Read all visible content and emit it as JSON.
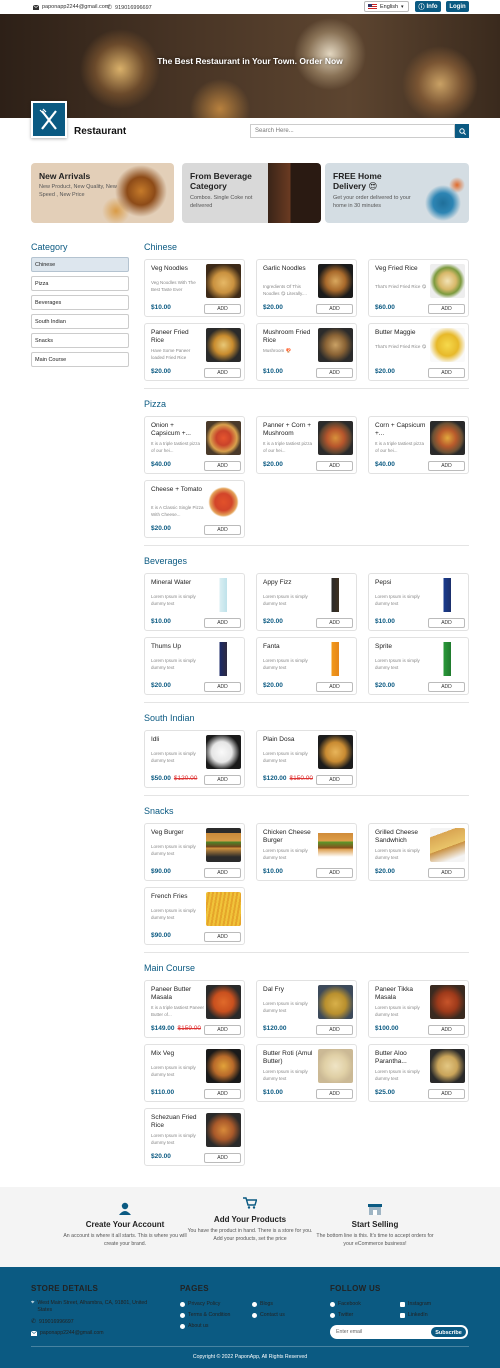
{
  "topbar": {
    "email": "paponapp2244@gmail.com",
    "phone": "919016996697",
    "language": "English",
    "info_label": "Info",
    "login_label": "Login"
  },
  "hero": {
    "title": "The Best Restaurant in Your Town. Order Now"
  },
  "header": {
    "brand": "Restaurant",
    "search_placeholder": "Search Here..."
  },
  "banners": [
    {
      "title": "New Arrivals",
      "subtitle": "New Product, New Quality, New Speed , New Price",
      "bg": "#e3cfb8"
    },
    {
      "title": "From Beverage Category",
      "subtitle": "Combos. Single Coke not delivered",
      "bg": "#d9d9d9"
    },
    {
      "title": "FREE Home Delivery 😍",
      "subtitle": "Get your order delivered to your home in 30 minutes",
      "bg": "#d4dde3"
    }
  ],
  "sidebar": {
    "title": "Category",
    "items": [
      "Chinese",
      "Pizza",
      "Beverages",
      "South Indian",
      "Snacks",
      "Main Course"
    ]
  },
  "add_label": "ADD",
  "sections": [
    {
      "title": "Chinese",
      "items": [
        {
          "name": "Veg Noodles",
          "desc": "Veg Noodles With The Best Taste Ever",
          "price": "$10.00",
          "old": "",
          "img": "noodles"
        },
        {
          "name": "Garlic Noodles",
          "desc": "Ingredients Of This Noodles 😋 Literally....",
          "price": "$20.00",
          "old": "",
          "img": "noodles2"
        },
        {
          "name": "Veg Fried Rice",
          "desc": "That's Fried Fried Rice 😋",
          "price": "$60.00",
          "old": "",
          "img": "rice"
        },
        {
          "name": "Paneer Fried Rice",
          "desc": "Have Some Paneer loaded Fried Rice",
          "price": "$20.00",
          "old": "",
          "img": "rice2"
        },
        {
          "name": "Mushroom Fried Rice",
          "desc": "Mushroom 🍄",
          "price": "$10.00",
          "old": "",
          "img": "rice3"
        },
        {
          "name": "Butter Maggie",
          "desc": "That's Fried Fried Rice 😋",
          "price": "$20.00",
          "old": "",
          "img": "maggie"
        }
      ]
    },
    {
      "title": "Pizza",
      "items": [
        {
          "name": "Onion + Capsicum +...",
          "desc": "It is a triple tastiest pizza of our hei...",
          "price": "$40.00",
          "old": "",
          "img": "pizza"
        },
        {
          "name": "Panner + Corn + Mushroom",
          "desc": "It is a triple tastiest pizza of our hei...",
          "price": "$20.00",
          "old": "",
          "img": "pizza2"
        },
        {
          "name": "Corn + Capsicum +...",
          "desc": "It is a triple tastiest pizza of our hei...",
          "price": "$40.00",
          "old": "",
          "img": "pizza3"
        },
        {
          "name": "Cheese + Tomato",
          "desc": "It is A Classic Single Pizza With Cheese...",
          "price": "$20.00",
          "old": "",
          "img": "pizza4"
        }
      ]
    },
    {
      "title": "Beverages",
      "items": [
        {
          "name": "Mineral Water",
          "desc": "Lorem Ipsum is simply dummy text",
          "price": "$10.00",
          "old": "",
          "img": "water"
        },
        {
          "name": "Appy Fizz",
          "desc": "Lorem Ipsum is simply dummy text",
          "price": "$20.00",
          "old": "",
          "img": "appy"
        },
        {
          "name": "Pepsi",
          "desc": "Lorem Ipsum is simply dummy text",
          "price": "$10.00",
          "old": "",
          "img": "pepsi"
        },
        {
          "name": "Thums Up",
          "desc": "Lorem Ipsum is simply dummy text",
          "price": "$20.00",
          "old": "",
          "img": "thumsup"
        },
        {
          "name": "Fanta",
          "desc": "Lorem Ipsum is simply dummy text",
          "price": "$20.00",
          "old": "",
          "img": "fanta"
        },
        {
          "name": "Sprite",
          "desc": "Lorem Ipsum is simply dummy text",
          "price": "$20.00",
          "old": "",
          "img": "sprite"
        }
      ]
    },
    {
      "title": "South Indian",
      "items": [
        {
          "name": "Idli",
          "desc": "Lorem Ipsum is simply dummy text",
          "price": "$50.00",
          "old": "$120.00",
          "img": "idli"
        },
        {
          "name": "Plain Dosa",
          "desc": "Lorem Ipsum is simply dummy text",
          "price": "$120.00",
          "old": "$150.00",
          "img": "dosa"
        }
      ]
    },
    {
      "title": "Snacks",
      "items": [
        {
          "name": "Veg Burger",
          "desc": "Lorem Ipsum is simply dummy text",
          "price": "$90.00",
          "old": "",
          "img": "burger"
        },
        {
          "name": "Chicken Cheese Burger",
          "desc": "Lorem Ipsum is simply dummy text",
          "price": "$10.00",
          "old": "",
          "img": "burger2"
        },
        {
          "name": "Grilled Cheese Sandwhich",
          "desc": "Lorem Ipsum is simply dummy text",
          "price": "$20.00",
          "old": "",
          "img": "sandwich"
        },
        {
          "name": "French Fries",
          "desc": "Lorem Ipsum is simply dummy text",
          "price": "$90.00",
          "old": "",
          "img": "fries"
        }
      ]
    },
    {
      "title": "Main Course",
      "items": [
        {
          "name": "Paneer Butter Masala",
          "desc": "It is a triple tastiest Paneer Butter of...",
          "price": "$149.00",
          "old": "$159.00",
          "img": "curry"
        },
        {
          "name": "Dal Fry",
          "desc": "Lorem Ipsum is simply dummy text",
          "price": "$120.00",
          "old": "",
          "img": "dal"
        },
        {
          "name": "Paneer Tikka Masala",
          "desc": "Lorem Ipsum is simply dummy text",
          "price": "$100.00",
          "old": "",
          "img": "curry2"
        },
        {
          "name": "Mix Veg",
          "desc": "Lorem Ipsum is simply dummy text",
          "price": "$110.00",
          "old": "",
          "img": "mixveg"
        },
        {
          "name": "Butter Roti (Amul Butter)",
          "desc": "Lorem Ipsum is simply dummy text",
          "price": "$10.00",
          "old": "",
          "img": "roti"
        },
        {
          "name": "Butter Aloo Parantha...",
          "desc": "Lorem Ipsum is simply dummy text",
          "price": "$25.00",
          "old": "",
          "img": "parantha"
        },
        {
          "name": "Schezuan Fried Rice",
          "desc": "Lorem Ipsum is simply dummy text",
          "price": "$20.00",
          "old": "",
          "img": "rice4"
        }
      ]
    }
  ],
  "features": [
    {
      "title": "Create Your Account",
      "desc": "An account is where it all starts. This is where you will create your brand.",
      "icon": "user-icon"
    },
    {
      "title": "Add Your Products",
      "desc": "You have the product in hand. There is a store for you. Add your products, set the price",
      "icon": "cart-icon"
    },
    {
      "title": "Start Selling",
      "desc": "The bottom line is this. It's time to accept orders for your eCommerce business!",
      "icon": "store-icon"
    }
  ],
  "footer": {
    "store_title": "STORE DETAILS",
    "address": "West Main Street, Alhambra, CA, 91801, United States",
    "phone": "919016996697",
    "email": "paponapp2244@gmail.com",
    "pages_title": "PAGES",
    "pages": [
      "Privacy Policy",
      "Blogs",
      "Terms & Condition",
      "Contact us",
      "About us"
    ],
    "follow_title": "FOLLOW US",
    "social": [
      "Facebook",
      "Instagram",
      "Twitter",
      "LinkedIn"
    ],
    "email_placeholder": "Enter email",
    "subscribe": "Subscribe",
    "copyright": "Copyright © 2022 PaponApp, All Rights Reserved"
  },
  "colors": {
    "accent": "#0b5a82",
    "price": "#0b5a82",
    "old_price": "#dd3333"
  }
}
